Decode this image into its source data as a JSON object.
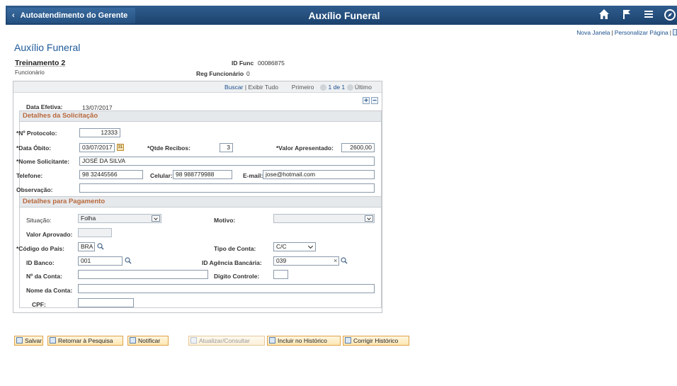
{
  "header": {
    "back_label": "Autoatendimento do Gerente",
    "title": "Auxílio Funeral",
    "icons": [
      "home-icon",
      "flag-icon",
      "menu-icon",
      "navbar-icon"
    ]
  },
  "toplinks": {
    "new_window": "Nova Janela",
    "personalize": "Personalizar Página",
    "separator": "|"
  },
  "page": {
    "heading": "Auxílio Funeral",
    "employee_name": "Treinamento 2",
    "employee_role": "Funcionário",
    "id_func_label": "ID Func",
    "id_func_value": "00086875",
    "reg_label": "Reg Funcionário",
    "reg_value": "0"
  },
  "nav": {
    "search": "Buscar",
    "separator": "|",
    "show_all": "Exibir Tudo",
    "first": "Primeiro",
    "range": "1 de 1",
    "last": "Último"
  },
  "effective": {
    "label": "Data Efetiva:",
    "value": "13/07/2017"
  },
  "request": {
    "title": "Detalhes da Solicitação",
    "protocol_label": "*Nº Protocolo:",
    "protocol_value": "12333",
    "death_date_label": "*Data Óbito:",
    "death_date_value": "03/07/2017",
    "receipts_label": "*Qtde Recibos:",
    "receipts_value": "3",
    "amount_label": "*Valor Apresentado:",
    "amount_value": "2600,00",
    "requester_label": "*Nome Solicitante:",
    "requester_value": "JOSÉ DA SILVA",
    "phone_label": "Telefone:",
    "phone_value": "98 32445566",
    "mobile_label": "Celular:",
    "mobile_value": "98 988779988",
    "email_label": "E-mail:",
    "email_value": "jose@hotmail.com",
    "notes_label": "Observação:",
    "notes_value": ""
  },
  "payment": {
    "title": "Detalhes para Pagamento",
    "status_label": "Situação:",
    "status_value": "Folha",
    "reason_label": "Motivo:",
    "reason_value": "",
    "approved_label": "Valor Aprovado:",
    "approved_value": "",
    "country_label": "*Código do País:",
    "country_value": "BRA",
    "account_type_label": "Tipo de Conta:",
    "account_type_value": "C/C",
    "bank_label": "ID Banco:",
    "bank_value": "001",
    "branch_label": "ID Agência Bancária:",
    "branch_value": "039",
    "account_no_label": "Nº da Conta:",
    "account_no_value": "",
    "check_digit_label": "Digito Controle:",
    "check_digit_value": "",
    "account_name_label": "Nome da Conta:",
    "account_name_value": "",
    "cpf_label": "CPF:",
    "cpf_value": ""
  },
  "buttons": {
    "save": "Salvar",
    "return": "Retornar à Pesquisa",
    "notify": "Notificar",
    "update": "Atualizar/Consultar",
    "include_history": "Incluir no Histórico",
    "correct_history": "Corrigir Histórico"
  }
}
